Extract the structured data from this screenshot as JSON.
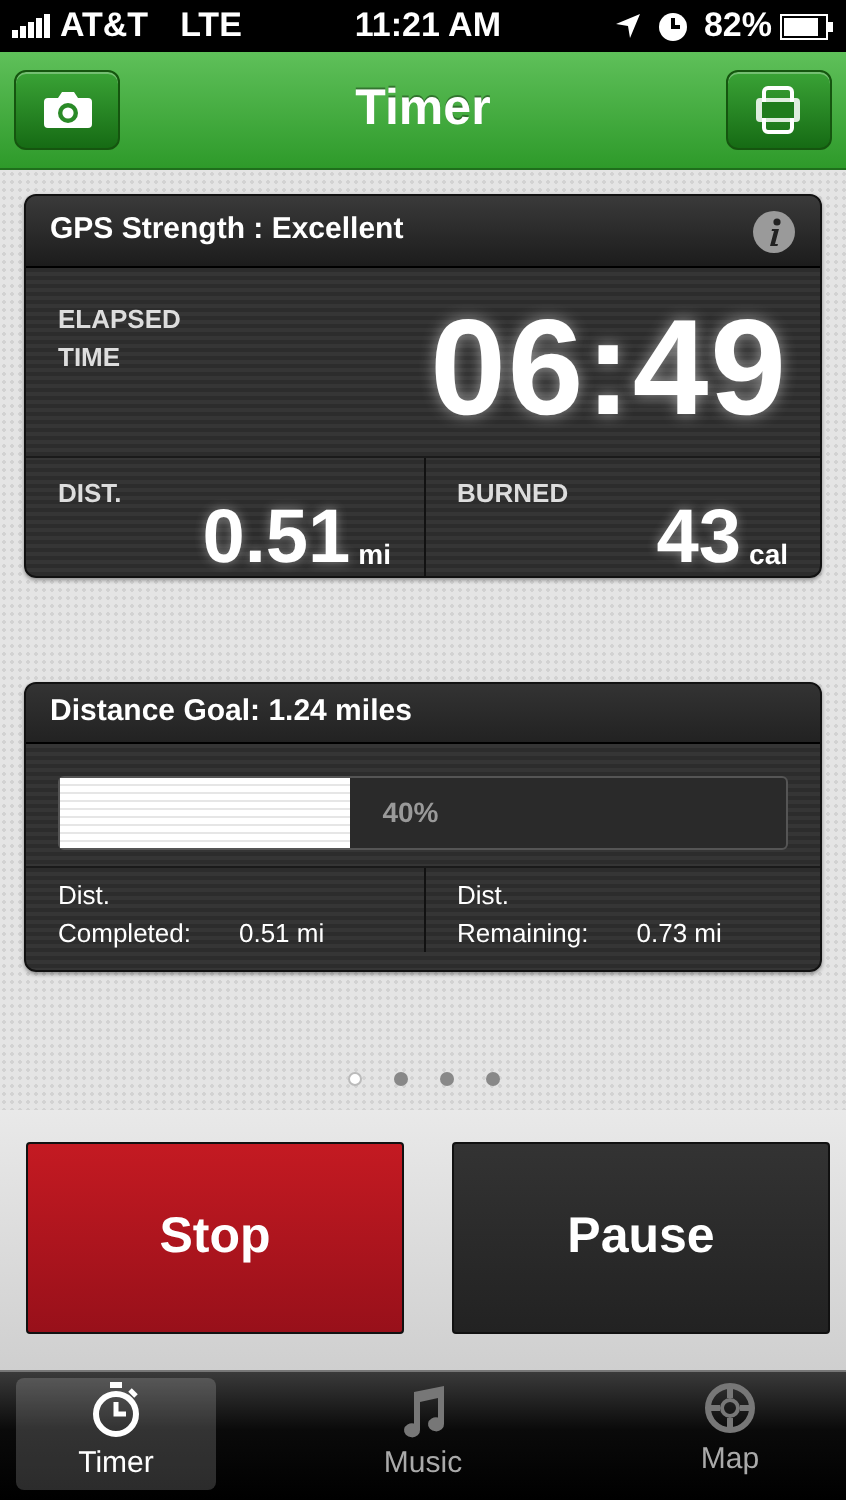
{
  "status_bar": {
    "carrier": "AT&T",
    "network": "LTE",
    "time": "11:21 AM",
    "battery": "82%"
  },
  "nav": {
    "title": "Timer"
  },
  "gps_card": {
    "title": "GPS Strength : Excellent",
    "elapsed_label": "ELAPSED\nTIME",
    "elapsed": "06:49",
    "distance_label": "DIST.",
    "distance": "0.51",
    "distance_unit": "mi",
    "burned_label": "BURNED",
    "burned": "43",
    "burned_unit": "cal"
  },
  "goal_card": {
    "title": "Distance Goal: 1.24 miles",
    "level": 0.4,
    "percent": "40%",
    "completed_label": "Dist.\nCompleted:",
    "completed": "0.51 mi",
    "remaining_label": "Dist.\nRemaining:",
    "remaining": "0.73 mi"
  },
  "pages": [
    {
      "selected": true
    },
    {
      "selected": false
    },
    {
      "selected": false
    },
    {
      "selected": false
    }
  ],
  "buttons": [
    {
      "label": "Stop",
      "kind": "stop"
    },
    {
      "label": "Pause",
      "kind": "pause"
    }
  ],
  "tabs": [
    {
      "label": "Timer",
      "selected": true
    },
    {
      "label": "Music",
      "selected": false
    },
    {
      "label": "Map",
      "selected": false
    }
  ]
}
